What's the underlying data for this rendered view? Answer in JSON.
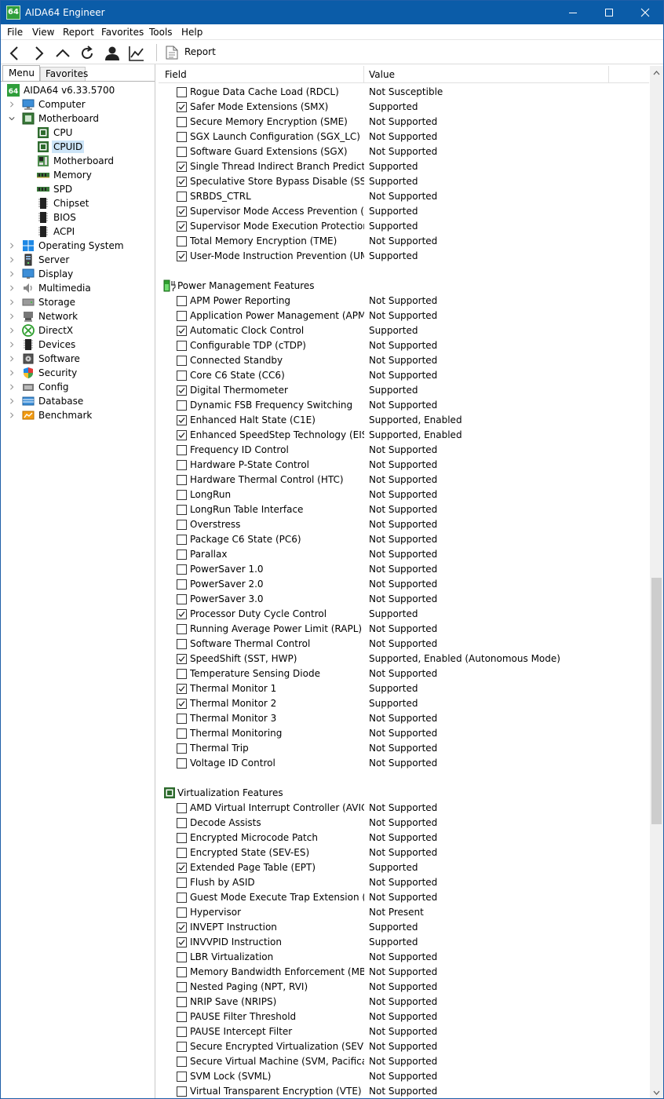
{
  "window": {
    "icon_text": "64",
    "title": "AIDA64 Engineer"
  },
  "menubar": [
    "File",
    "View",
    "Report",
    "Favorites",
    "Tools",
    "Help"
  ],
  "toolbar": {
    "buttons": [
      "back-icon",
      "forward-icon",
      "up-icon",
      "refresh-icon",
      "user-icon",
      "chart-icon"
    ],
    "report_label": "Report"
  },
  "left_tabs": [
    "Menu",
    "Favorites"
  ],
  "tree": [
    {
      "label": "AIDA64 v6.33.5700",
      "level": 0,
      "icon": "aida64-icon"
    },
    {
      "label": "Computer",
      "level": 1,
      "icon": "computer-icon",
      "arrow": "collapsed"
    },
    {
      "label": "Motherboard",
      "level": 1,
      "icon": "motherboard-icon",
      "arrow": "expanded"
    },
    {
      "label": "CPU",
      "level": 2,
      "icon": "cpu-icon"
    },
    {
      "label": "CPUID",
      "level": 2,
      "icon": "cpuid-icon",
      "selected": true
    },
    {
      "label": "Motherboard",
      "level": 2,
      "icon": "motherboard-board-icon"
    },
    {
      "label": "Memory",
      "level": 2,
      "icon": "memory-icon"
    },
    {
      "label": "SPD",
      "level": 2,
      "icon": "spd-icon"
    },
    {
      "label": "Chipset",
      "level": 2,
      "icon": "chipset-icon"
    },
    {
      "label": "BIOS",
      "level": 2,
      "icon": "bios-icon"
    },
    {
      "label": "ACPI",
      "level": 2,
      "icon": "acpi-icon"
    },
    {
      "label": "Operating System",
      "level": 1,
      "icon": "windows-icon",
      "arrow": "collapsed"
    },
    {
      "label": "Server",
      "level": 1,
      "icon": "server-icon",
      "arrow": "collapsed"
    },
    {
      "label": "Display",
      "level": 1,
      "icon": "display-icon",
      "arrow": "collapsed"
    },
    {
      "label": "Multimedia",
      "level": 1,
      "icon": "multimedia-icon",
      "arrow": "collapsed"
    },
    {
      "label": "Storage",
      "level": 1,
      "icon": "storage-icon",
      "arrow": "collapsed"
    },
    {
      "label": "Network",
      "level": 1,
      "icon": "network-icon",
      "arrow": "collapsed"
    },
    {
      "label": "DirectX",
      "level": 1,
      "icon": "directx-icon",
      "arrow": "collapsed"
    },
    {
      "label": "Devices",
      "level": 1,
      "icon": "devices-icon",
      "arrow": "collapsed"
    },
    {
      "label": "Software",
      "level": 1,
      "icon": "software-icon",
      "arrow": "collapsed"
    },
    {
      "label": "Security",
      "level": 1,
      "icon": "security-icon",
      "arrow": "collapsed"
    },
    {
      "label": "Config",
      "level": 1,
      "icon": "config-icon",
      "arrow": "collapsed"
    },
    {
      "label": "Database",
      "level": 1,
      "icon": "database-icon",
      "arrow": "collapsed"
    },
    {
      "label": "Benchmark",
      "level": 1,
      "icon": "benchmark-icon",
      "arrow": "collapsed"
    }
  ],
  "columns": {
    "field": "Field",
    "value": "Value"
  },
  "rows": [
    {
      "type": "item",
      "checked": false,
      "field": "Rogue Data Cache Load (RDCL)",
      "value": "Not Susceptible"
    },
    {
      "type": "item",
      "checked": true,
      "field": "Safer Mode Extensions (SMX)",
      "value": "Supported"
    },
    {
      "type": "item",
      "checked": false,
      "field": "Secure Memory Encryption (SME)",
      "value": "Not Supported"
    },
    {
      "type": "item",
      "checked": false,
      "field": "SGX Launch Configuration (SGX_LC)",
      "value": "Not Supported"
    },
    {
      "type": "item",
      "checked": false,
      "field": "Software Guard Extensions (SGX)",
      "value": "Not Supported"
    },
    {
      "type": "item",
      "checked": true,
      "field": "Single Thread Indirect Branch Predictors...",
      "value": "Supported"
    },
    {
      "type": "item",
      "checked": true,
      "field": "Speculative Store Bypass Disable (SSBD)",
      "value": "Supported"
    },
    {
      "type": "item",
      "checked": false,
      "field": "SRBDS_CTRL",
      "value": "Not Supported"
    },
    {
      "type": "item",
      "checked": true,
      "field": "Supervisor Mode Access Prevention (S...",
      "value": "Supported"
    },
    {
      "type": "item",
      "checked": true,
      "field": "Supervisor Mode Execution Protection (...",
      "value": "Supported"
    },
    {
      "type": "item",
      "checked": false,
      "field": "Total Memory Encryption (TME)",
      "value": "Not Supported"
    },
    {
      "type": "item",
      "checked": true,
      "field": "User-Mode Instruction Prevention (UMIP)",
      "value": "Supported"
    },
    {
      "type": "blank"
    },
    {
      "type": "section",
      "title": "Power Management Features",
      "icon": "power-icon"
    },
    {
      "type": "item",
      "checked": false,
      "field": "APM Power Reporting",
      "value": "Not Supported"
    },
    {
      "type": "item",
      "checked": false,
      "field": "Application Power Management (APM)",
      "value": "Not Supported"
    },
    {
      "type": "item",
      "checked": true,
      "field": "Automatic Clock Control",
      "value": "Supported"
    },
    {
      "type": "item",
      "checked": false,
      "field": "Configurable TDP (cTDP)",
      "value": "Not Supported"
    },
    {
      "type": "item",
      "checked": false,
      "field": "Connected Standby",
      "value": "Not Supported"
    },
    {
      "type": "item",
      "checked": false,
      "field": "Core C6 State (CC6)",
      "value": "Not Supported"
    },
    {
      "type": "item",
      "checked": true,
      "field": "Digital Thermometer",
      "value": "Supported"
    },
    {
      "type": "item",
      "checked": false,
      "field": "Dynamic FSB Frequency Switching",
      "value": "Not Supported"
    },
    {
      "type": "item",
      "checked": true,
      "field": "Enhanced Halt State (C1E)",
      "value": "Supported, Enabled"
    },
    {
      "type": "item",
      "checked": true,
      "field": "Enhanced SpeedStep Technology (EIST, ...",
      "value": "Supported, Enabled"
    },
    {
      "type": "item",
      "checked": false,
      "field": "Frequency ID Control",
      "value": "Not Supported"
    },
    {
      "type": "item",
      "checked": false,
      "field": "Hardware P-State Control",
      "value": "Not Supported"
    },
    {
      "type": "item",
      "checked": false,
      "field": "Hardware Thermal Control (HTC)",
      "value": "Not Supported"
    },
    {
      "type": "item",
      "checked": false,
      "field": "LongRun",
      "value": "Not Supported"
    },
    {
      "type": "item",
      "checked": false,
      "field": "LongRun Table Interface",
      "value": "Not Supported"
    },
    {
      "type": "item",
      "checked": false,
      "field": "Overstress",
      "value": "Not Supported"
    },
    {
      "type": "item",
      "checked": false,
      "field": "Package C6 State (PC6)",
      "value": "Not Supported"
    },
    {
      "type": "item",
      "checked": false,
      "field": "Parallax",
      "value": "Not Supported"
    },
    {
      "type": "item",
      "checked": false,
      "field": "PowerSaver 1.0",
      "value": "Not Supported"
    },
    {
      "type": "item",
      "checked": false,
      "field": "PowerSaver 2.0",
      "value": "Not Supported"
    },
    {
      "type": "item",
      "checked": false,
      "field": "PowerSaver 3.0",
      "value": "Not Supported"
    },
    {
      "type": "item",
      "checked": true,
      "field": "Processor Duty Cycle Control",
      "value": "Supported"
    },
    {
      "type": "item",
      "checked": false,
      "field": "Running Average Power Limit (RAPL)",
      "value": "Not Supported"
    },
    {
      "type": "item",
      "checked": false,
      "field": "Software Thermal Control",
      "value": "Not Supported"
    },
    {
      "type": "item",
      "checked": true,
      "field": "SpeedShift (SST, HWP)",
      "value": "Supported, Enabled (Autonomous Mode)"
    },
    {
      "type": "item",
      "checked": false,
      "field": "Temperature Sensing Diode",
      "value": "Not Supported"
    },
    {
      "type": "item",
      "checked": true,
      "field": "Thermal Monitor 1",
      "value": "Supported"
    },
    {
      "type": "item",
      "checked": true,
      "field": "Thermal Monitor 2",
      "value": "Supported"
    },
    {
      "type": "item",
      "checked": false,
      "field": "Thermal Monitor 3",
      "value": "Not Supported"
    },
    {
      "type": "item",
      "checked": false,
      "field": "Thermal Monitoring",
      "value": "Not Supported"
    },
    {
      "type": "item",
      "checked": false,
      "field": "Thermal Trip",
      "value": "Not Supported"
    },
    {
      "type": "item",
      "checked": false,
      "field": "Voltage ID Control",
      "value": "Not Supported"
    },
    {
      "type": "blank"
    },
    {
      "type": "section",
      "title": "Virtualization Features",
      "icon": "virtualization-chip-icon"
    },
    {
      "type": "item",
      "checked": false,
      "field": "AMD Virtual Interrupt Controller (AVIC)",
      "value": "Not Supported"
    },
    {
      "type": "item",
      "checked": false,
      "field": "Decode Assists",
      "value": "Not Supported"
    },
    {
      "type": "item",
      "checked": false,
      "field": "Encrypted Microcode Patch",
      "value": "Not Supported"
    },
    {
      "type": "item",
      "checked": false,
      "field": "Encrypted State (SEV-ES)",
      "value": "Not Supported"
    },
    {
      "type": "item",
      "checked": true,
      "field": "Extended Page Table (EPT)",
      "value": "Supported"
    },
    {
      "type": "item",
      "checked": false,
      "field": "Flush by ASID",
      "value": "Not Supported"
    },
    {
      "type": "item",
      "checked": false,
      "field": "Guest Mode Execute Trap Extension (G...",
      "value": "Not Supported"
    },
    {
      "type": "item",
      "checked": false,
      "field": "Hypervisor",
      "value": "Not Present"
    },
    {
      "type": "item",
      "checked": true,
      "field": "INVEPT Instruction",
      "value": "Supported"
    },
    {
      "type": "item",
      "checked": true,
      "field": "INVVPID Instruction",
      "value": "Supported"
    },
    {
      "type": "item",
      "checked": false,
      "field": "LBR Virtualization",
      "value": "Not Supported"
    },
    {
      "type": "item",
      "checked": false,
      "field": "Memory Bandwidth Enforcement (MBE)",
      "value": "Not Supported"
    },
    {
      "type": "item",
      "checked": false,
      "field": "Nested Paging (NPT, RVI)",
      "value": "Not Supported"
    },
    {
      "type": "item",
      "checked": false,
      "field": "NRIP Save (NRIPS)",
      "value": "Not Supported"
    },
    {
      "type": "item",
      "checked": false,
      "field": "PAUSE Filter Threshold",
      "value": "Not Supported"
    },
    {
      "type": "item",
      "checked": false,
      "field": "PAUSE Intercept Filter",
      "value": "Not Supported"
    },
    {
      "type": "item",
      "checked": false,
      "field": "Secure Encrypted Virtualization (SEV)",
      "value": "Not Supported"
    },
    {
      "type": "item",
      "checked": false,
      "field": "Secure Virtual Machine (SVM, Pacifica)",
      "value": "Not Supported"
    },
    {
      "type": "item",
      "checked": false,
      "field": "SVM Lock (SVML)",
      "value": "Not Supported"
    },
    {
      "type": "item",
      "checked": false,
      "field": "Virtual Transparent Encryption (VTE)",
      "value": "Not Supported"
    }
  ],
  "scroll_position": 0.5
}
